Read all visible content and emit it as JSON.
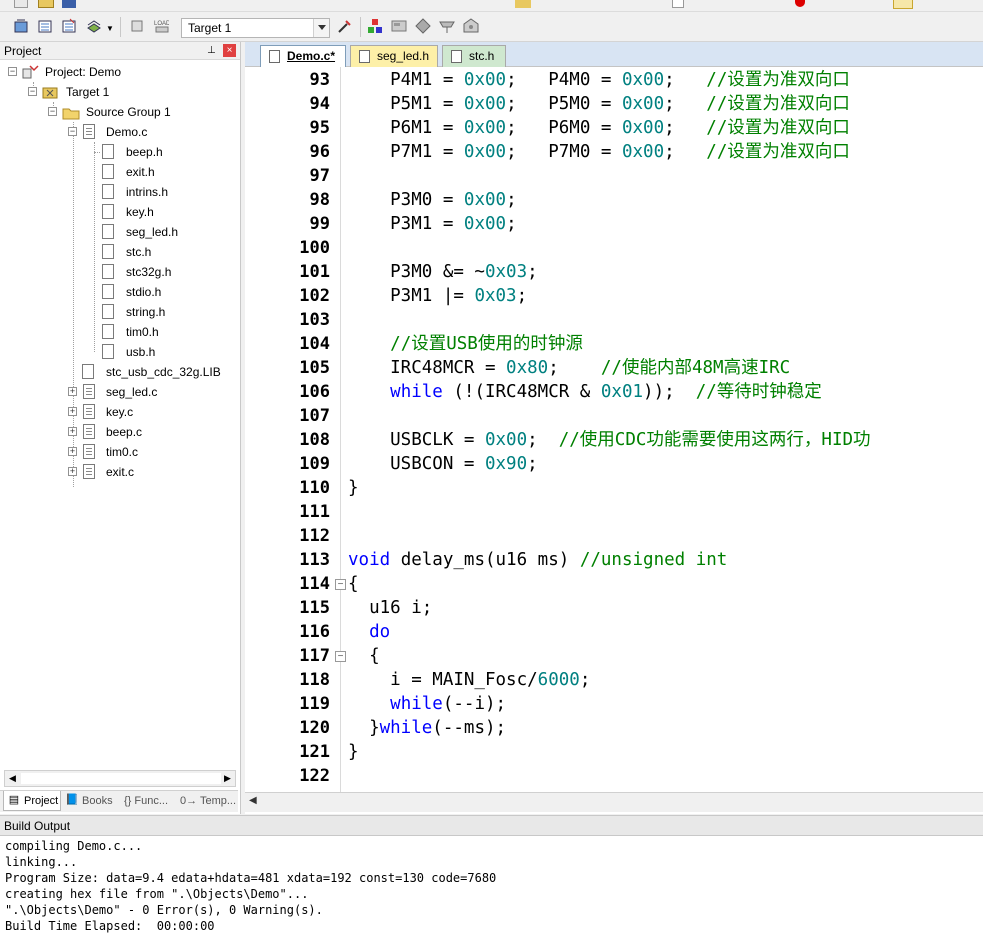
{
  "toolbar": {
    "target_value": "Target 1"
  },
  "project_pane": {
    "title": "Project",
    "pin": "Ա",
    "close": "×",
    "tree": {
      "project": "Project: Demo",
      "target": "Target 1",
      "group": "Source Group 1",
      "demo_file": "Demo.c",
      "demo_includes": [
        "beep.h",
        "exit.h",
        "intrins.h",
        "key.h",
        "seg_led.h",
        "stc.h",
        "stc32g.h",
        "stdio.h",
        "string.h",
        "tim0.h",
        "usb.h"
      ],
      "lib": "stc_usb_cdc_32g.LIB",
      "other_files": [
        "seg_led.c",
        "key.c",
        "beep.c",
        "tim0.c",
        "exit.c"
      ]
    },
    "tabs": [
      "Project",
      "Books",
      "{} Func...",
      "0→ Temp..."
    ]
  },
  "editor": {
    "tabs": [
      "Demo.c*",
      "seg_led.h",
      "stc.h"
    ],
    "active_tab": "Demo.c*",
    "lines": [
      {
        "n": "93",
        "t": "    P4M1 = 0x00;   P4M0 = 0x00;   //设置为准双向口"
      },
      {
        "n": "94",
        "t": "    P5M1 = 0x00;   P5M0 = 0x00;   //设置为准双向口"
      },
      {
        "n": "95",
        "t": "    P6M1 = 0x00;   P6M0 = 0x00;   //设置为准双向口"
      },
      {
        "n": "96",
        "t": "    P7M1 = 0x00;   P7M0 = 0x00;   //设置为准双向口"
      },
      {
        "n": "97",
        "t": ""
      },
      {
        "n": "98",
        "t": "    P3M0 = 0x00;"
      },
      {
        "n": "99",
        "t": "    P3M1 = 0x00;"
      },
      {
        "n": "100",
        "t": ""
      },
      {
        "n": "101",
        "t": "    P3M0 &= ~0x03;"
      },
      {
        "n": "102",
        "t": "    P3M1 |= 0x03;"
      },
      {
        "n": "103",
        "t": ""
      },
      {
        "n": "104",
        "t": "    //设置USB使用的时钟源"
      },
      {
        "n": "105",
        "t": "    IRC48MCR = 0x80;    //使能内部48M高速IRC"
      },
      {
        "n": "106",
        "t": "    while (!(IRC48MCR & 0x01));  //等待时钟稳定"
      },
      {
        "n": "107",
        "t": ""
      },
      {
        "n": "108",
        "t": "    USBCLK = 0x00;  //使用CDC功能需要使用这两行，HID功"
      },
      {
        "n": "109",
        "t": "    USBCON = 0x90;"
      },
      {
        "n": "110",
        "t": "}"
      },
      {
        "n": "111",
        "t": ""
      },
      {
        "n": "112",
        "t": ""
      },
      {
        "n": "113",
        "t": "void delay_ms(u16 ms) //unsigned int"
      },
      {
        "n": "114",
        "t": "{"
      },
      {
        "n": "115",
        "t": "  u16 i;"
      },
      {
        "n": "116",
        "t": "  do"
      },
      {
        "n": "117",
        "t": "  {"
      },
      {
        "n": "118",
        "t": "    i = MAIN_Fosc/6000;"
      },
      {
        "n": "119",
        "t": "    while(--i);"
      },
      {
        "n": "120",
        "t": "  }while(--ms);"
      },
      {
        "n": "121",
        "t": "}"
      },
      {
        "n": "122",
        "t": ""
      }
    ]
  },
  "build_output": {
    "title": "Build Output",
    "lines": [
      "compiling Demo.c...",
      "linking...",
      "Program Size: data=9.4 edata+hdata=481 xdata=192 const=130 code=7680",
      "creating hex file from \".\\Objects\\Demo\"...",
      "\".\\Objects\\Demo\" - 0 Error(s), 0 Warning(s).",
      "Build Time Elapsed:  00:00:00"
    ]
  },
  "colors": {
    "keyword": "#0000ff",
    "number": "#008080",
    "comment": "#008000",
    "tabbar": "#d8e4f3"
  }
}
